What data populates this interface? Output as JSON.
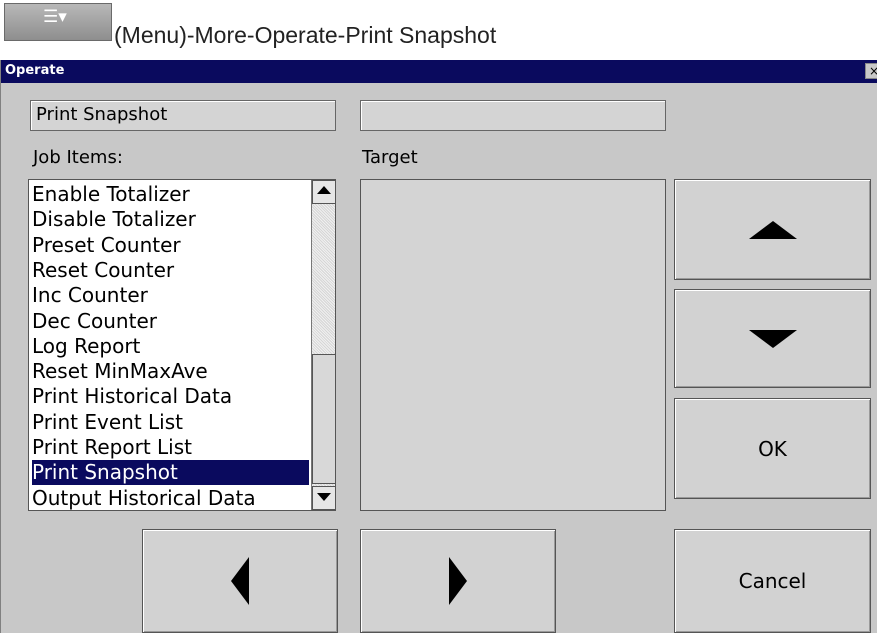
{
  "caption": {
    "menu_icon": "☰▾",
    "text": "(Menu)-More-Operate-Print Snapshot"
  },
  "window": {
    "title": "Operate",
    "close_glyph": "×"
  },
  "job": {
    "selected_value": "Print Snapshot",
    "label": "Job Items:",
    "items": [
      "Enable Totalizer",
      "Disable Totalizer",
      "Preset Counter",
      "Reset Counter",
      "Inc Counter",
      "Dec Counter",
      "Log Report",
      "Reset MinMaxAve",
      "Print Historical Data",
      "Print Event List",
      "Print Report List",
      "Print Snapshot",
      "Output Historical Data"
    ],
    "selected_index": 11
  },
  "target": {
    "value": "",
    "label": "Target"
  },
  "buttons": {
    "ok": "OK",
    "cancel": "Cancel"
  },
  "colors": {
    "titlebar": "#0a0a5e",
    "selection": "#0a0a5e",
    "window_bg": "#c8c8c8"
  }
}
